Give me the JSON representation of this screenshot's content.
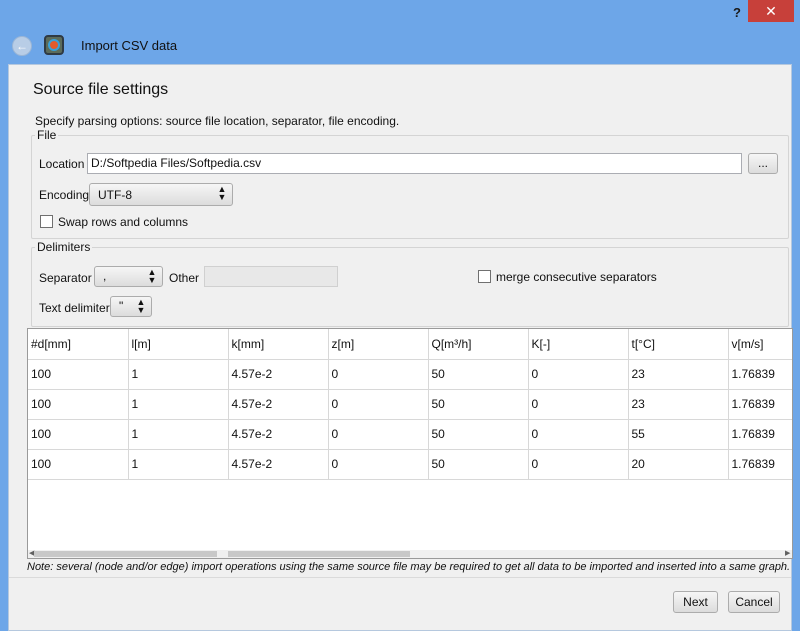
{
  "window": {
    "help_label": "?",
    "close_label": "✕"
  },
  "header": {
    "title": "Import CSV data",
    "back_glyph": "←"
  },
  "page": {
    "title": "Source file settings",
    "subtitle": "Specify parsing options: source file location, separator, file encoding."
  },
  "file_group": {
    "legend": "File",
    "location_label": "Location",
    "location_value": "D:/Softpedia Files/Softpedia.csv",
    "browse_label": "...",
    "encoding_label": "Encoding",
    "encoding_value": "UTF-8",
    "swap_label": "Swap rows and columns",
    "swap_checked": false
  },
  "delimiters_group": {
    "legend": "Delimiters",
    "separator_label": "Separator",
    "separator_value": ",",
    "other_label": "Other",
    "other_value": "",
    "merge_label": "merge consecutive separators",
    "merge_checked": false,
    "text_delimiter_label": "Text delimiter",
    "text_delimiter_value": "\""
  },
  "table": {
    "columns": [
      "#d[mm]",
      "l[m]",
      "k[mm]",
      "z[m]",
      "Q[m³/h]",
      "K[-]",
      "t[°C]",
      "v[m/s]"
    ],
    "rows": [
      [
        "100",
        "1",
        "4.57e-2",
        "0",
        "50",
        "0",
        "23",
        "1.76839"
      ],
      [
        "100",
        "1",
        "4.57e-2",
        "0",
        "50",
        "0",
        "23",
        "1.76839"
      ],
      [
        "100",
        "1",
        "4.57e-2",
        "0",
        "50",
        "0",
        "55",
        "1.76839"
      ],
      [
        "100",
        "1",
        "4.57e-2",
        "0",
        "50",
        "0",
        "20",
        "1.76839"
      ]
    ]
  },
  "note": "Note: several (node and/or edge) import operations using the same source file may be required to get all data to be imported and inserted into a same graph.",
  "footer": {
    "next_label": "Next",
    "cancel_label": "Cancel"
  },
  "colors": {
    "titlebar": "#6da6e8",
    "close": "#c7403a",
    "panel": "#f0f0f0"
  }
}
